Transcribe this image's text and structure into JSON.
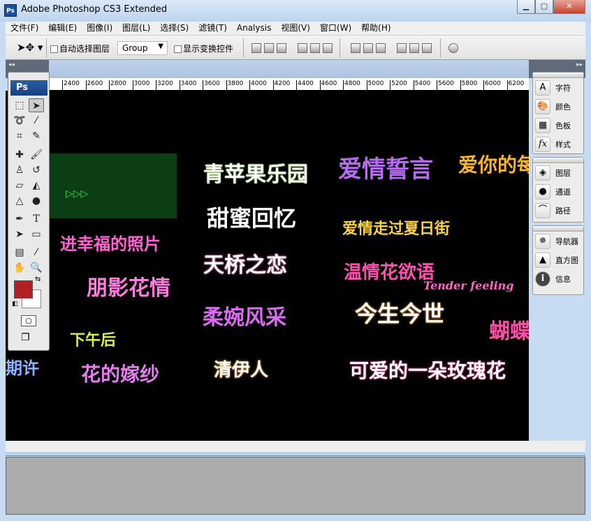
{
  "window": {
    "title": "Adobe Photoshop CS3 Extended",
    "app_icon": "Ps",
    "controls": {
      "minimize": "▁",
      "maximize": "▢",
      "close": "✕"
    }
  },
  "menu": [
    "文件(F)",
    "编辑(E)",
    "图像(I)",
    "图层(L)",
    "选择(S)",
    "滤镜(T)",
    "Analysis",
    "视图(V)",
    "窗口(W)",
    "帮助(H)"
  ],
  "options": {
    "auto_select_label": "自动选择图层",
    "auto_select_checked": false,
    "auto_select_value": "Group",
    "show_transform_label": "显示变换控件",
    "show_transform_checked": false
  },
  "ruler": {
    "ticks": [
      "2400",
      "2600",
      "2800",
      "3000",
      "3200",
      "3400",
      "3600",
      "3800",
      "4000",
      "4200",
      "4400",
      "4600",
      "4800",
      "5000",
      "5200",
      "5400",
      "5600",
      "5800",
      "6000",
      "6200"
    ]
  },
  "toolbox": {
    "logo": "Ps",
    "foreground_color": "#b21f24",
    "background_color": "#ffffff"
  },
  "panels": [
    {
      "items": [
        {
          "icon": "character-icon",
          "glyph": "A",
          "label": "字符"
        },
        {
          "icon": "color-palette-icon",
          "glyph": "🎨",
          "label": "颜色"
        },
        {
          "icon": "swatches-icon",
          "glyph": "▦",
          "label": "色板"
        },
        {
          "icon": "styles-icon",
          "glyph": "fx",
          "label": "样式"
        }
      ]
    },
    {
      "items": [
        {
          "icon": "layers-icon",
          "glyph": "◈",
          "label": "图层"
        },
        {
          "icon": "channels-icon",
          "glyph": "●",
          "label": "通道"
        },
        {
          "icon": "paths-icon",
          "glyph": "⌒",
          "label": "路径"
        }
      ]
    },
    {
      "items": [
        {
          "icon": "navigator-icon",
          "glyph": "✵",
          "label": "导航器"
        },
        {
          "icon": "histogram-icon",
          "glyph": "▲",
          "label": "直方图"
        },
        {
          "icon": "info-icon",
          "glyph": "i",
          "label": "信息"
        }
      ]
    }
  ],
  "canvas": {
    "artworks": [
      {
        "text": "青苹果乐园",
        "color": "#ffffff",
        "accent": "#7ee23a"
      },
      {
        "text": "爱情誓言",
        "color": "#b56cf0"
      },
      {
        "text": "爱你的每",
        "color": "#f7b52b"
      },
      {
        "text": "甜蜜回忆",
        "color": "#ffffff"
      },
      {
        "text": "爱情走过夏日街",
        "color": "#f9d342"
      },
      {
        "text": "天桥之恋",
        "color": "#ffffff",
        "accent": "#ff6ec7"
      },
      {
        "text": "温情花欲语",
        "color": "#ff4fb0"
      },
      {
        "text": "Tender feeling",
        "color": "#ff66c4"
      },
      {
        "text": "进幸福的照片",
        "color": "#ff62d3"
      },
      {
        "text": "朋影花情",
        "color": "#ff7ee0"
      },
      {
        "text": "柔婉风采",
        "color": "#d96cf0"
      },
      {
        "text": "今生今世",
        "color": "#ffffff",
        "accent": "#ff9d2e"
      },
      {
        "text": "蝴蝶梦",
        "color": "#ff4fa8"
      },
      {
        "text": "下午后",
        "color": "#d8f04a"
      },
      {
        "text": "期许",
        "color": "#8ab4ff"
      },
      {
        "text": "花的嫁纱",
        "color": "#e77ef0"
      },
      {
        "text": "清伊人",
        "color": "#ffffff",
        "accent": "#ffaa33"
      },
      {
        "text": "可爱的一朵玫瑰花",
        "color": "#ffffff",
        "accent": "#ff3fa0"
      },
      {
        "text": "▷▷▷",
        "color": "#2ee84a"
      }
    ]
  }
}
